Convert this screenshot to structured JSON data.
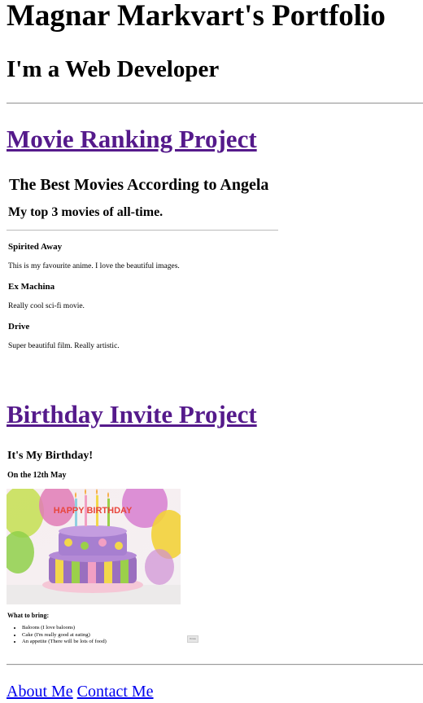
{
  "header": {
    "title": "Magnar Markvart's Portfolio",
    "subtitle": "I'm a Web Developer"
  },
  "projects": {
    "movie_link": "Movie Ranking Project",
    "birthday_link": "Birthday Invite Project"
  },
  "movie_page": {
    "title": "The Best Movies According to Angela",
    "subtitle": "My top 3 movies of all-time.",
    "movies": [
      {
        "name": "Spirited Away",
        "desc": "This is my favourite anime. I love the beautiful images."
      },
      {
        "name": "Ex Machina",
        "desc": "Really cool sci-fi movie."
      },
      {
        "name": "Drive",
        "desc": "Super beautiful film. Really artistic."
      }
    ]
  },
  "birthday_page": {
    "title": "It's My Birthday!",
    "date": "On the 12th May",
    "cake_text": "HAPPY BIRTHDAY",
    "bring_heading": "What to bring:",
    "items": [
      "Baloons (I love baloons)",
      "Cake (I'm really good at eating)",
      "An appetite (There will be lots of food)"
    ],
    "button_label": "Know"
  },
  "footer": {
    "about": "About Me",
    "contact": "Contact Me"
  }
}
